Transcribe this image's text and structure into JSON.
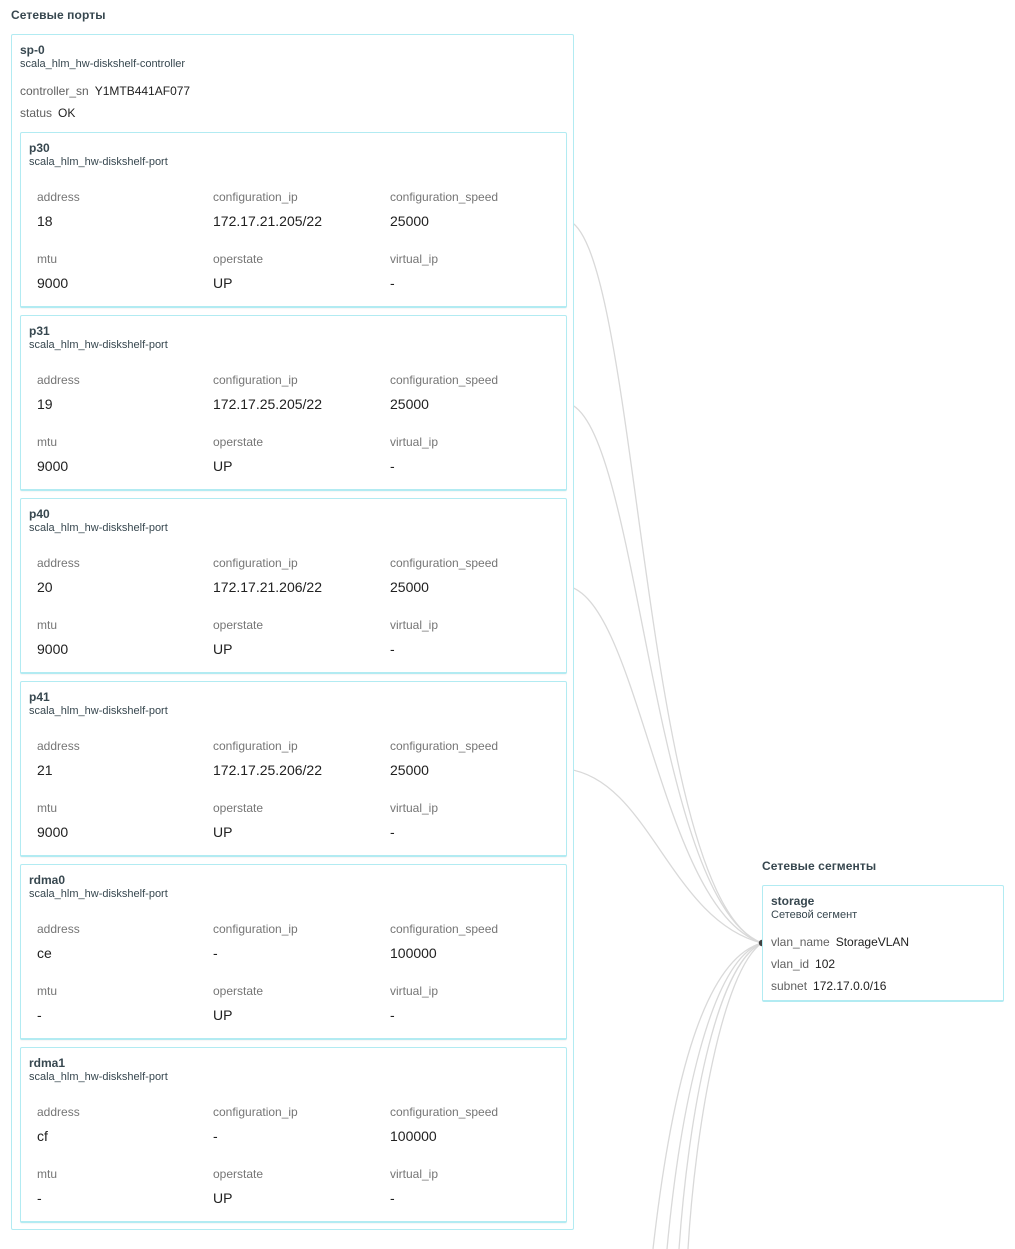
{
  "ports_section": {
    "title": "Сетевые порты"
  },
  "segments_section": {
    "title": "Сетевые сегменты"
  },
  "controller": {
    "name": "sp-0",
    "type": "scala_hlm_hw-diskshelf-controller",
    "fields": [
      {
        "key": "controller_sn",
        "value": "Y1MTB441AF077"
      },
      {
        "key": "status",
        "value": "OK"
      }
    ]
  },
  "field_labels": {
    "address": "address",
    "configuration_ip": "configuration_ip",
    "configuration_speed": "configuration_speed",
    "mtu": "mtu",
    "operstate": "operstate",
    "virtual_ip": "virtual_ip"
  },
  "ports": [
    {
      "name": "p30",
      "type": "scala_hlm_hw-diskshelf-port",
      "address": "18",
      "configuration_ip": "172.17.21.205/22",
      "configuration_speed": "25000",
      "mtu": "9000",
      "operstate": "UP",
      "virtual_ip": "-"
    },
    {
      "name": "p31",
      "type": "scala_hlm_hw-diskshelf-port",
      "address": "19",
      "configuration_ip": "172.17.25.205/22",
      "configuration_speed": "25000",
      "mtu": "9000",
      "operstate": "UP",
      "virtual_ip": "-"
    },
    {
      "name": "p40",
      "type": "scala_hlm_hw-diskshelf-port",
      "address": "20",
      "configuration_ip": "172.17.21.206/22",
      "configuration_speed": "25000",
      "mtu": "9000",
      "operstate": "UP",
      "virtual_ip": "-"
    },
    {
      "name": "p41",
      "type": "scala_hlm_hw-diskshelf-port",
      "address": "21",
      "configuration_ip": "172.17.25.206/22",
      "configuration_speed": "25000",
      "mtu": "9000",
      "operstate": "UP",
      "virtual_ip": "-"
    },
    {
      "name": "rdma0",
      "type": "scala_hlm_hw-diskshelf-port",
      "address": "ce",
      "configuration_ip": "-",
      "configuration_speed": "100000",
      "mtu": "-",
      "operstate": "UP",
      "virtual_ip": "-"
    },
    {
      "name": "rdma1",
      "type": "scala_hlm_hw-diskshelf-port",
      "address": "cf",
      "configuration_ip": "-",
      "configuration_speed": "100000",
      "mtu": "-",
      "operstate": "UP",
      "virtual_ip": "-"
    }
  ],
  "segment": {
    "name": "storage",
    "type": "Сетевой сегмент",
    "fields": [
      {
        "key": "vlan_name",
        "value": "StorageVLAN"
      },
      {
        "key": "vlan_id",
        "value": "102"
      },
      {
        "key": "subnet",
        "value": "172.17.0.0/16"
      }
    ]
  },
  "colors": {
    "border": "#b2ebf2",
    "link": "#d6d6d6",
    "link_anchor": "#424242"
  }
}
